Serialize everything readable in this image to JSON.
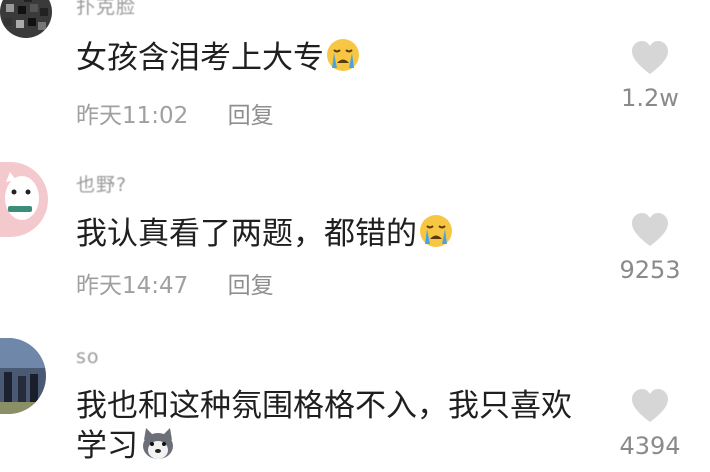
{
  "comments": [
    {
      "username": "扑克脸",
      "text": "女孩含泪考上大专",
      "emoji": "crying-face",
      "time": "昨天11:02",
      "reply_label": "回复",
      "likes": "1.2w"
    },
    {
      "username": "也野?",
      "text": "我认真看了两题，都错的",
      "emoji": "crying-face",
      "time": "昨天14:47",
      "reply_label": "回复",
      "likes": "9253"
    },
    {
      "username": "so",
      "text_line1": "我也和这种氛围格格不入，我只喜欢",
      "text_line2": "学习",
      "emoji": "husky-face",
      "likes": "4394"
    }
  ],
  "colors": {
    "text": "#1f1f1f",
    "meta": "#a0a0a0",
    "heart": "#d6d6d6",
    "emoji_face": "#f7c744",
    "emoji_tear": "#4aa3df"
  }
}
